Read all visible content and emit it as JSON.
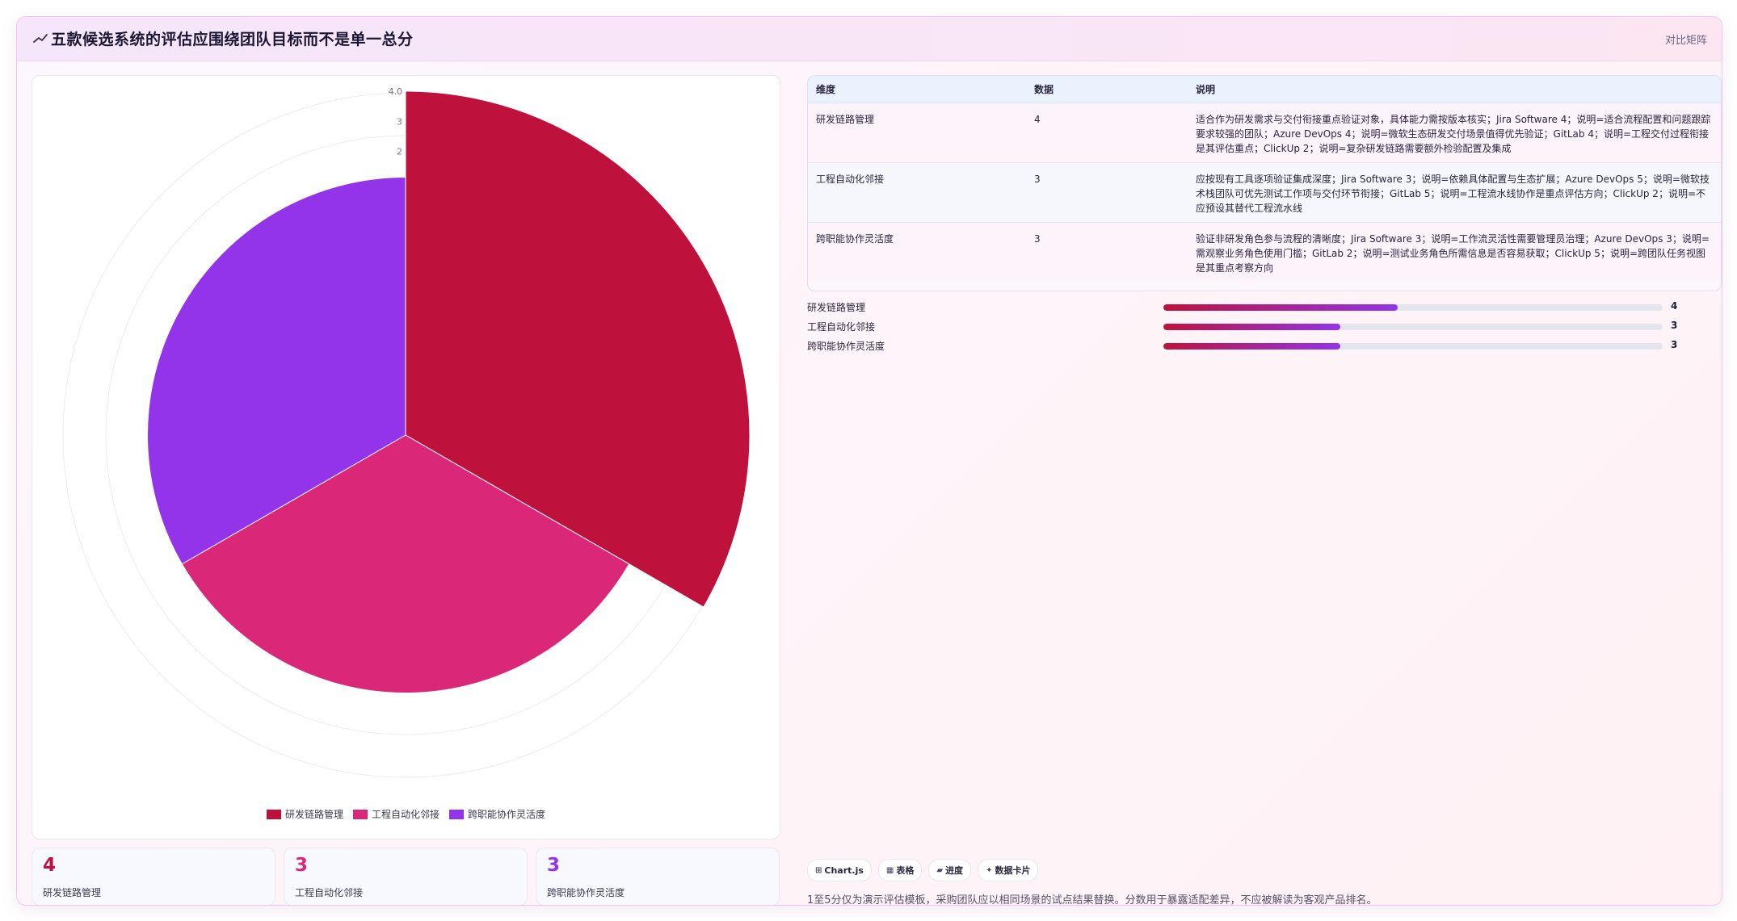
{
  "header": {
    "title": "五款候选系统的评估应围绕团队目标而不是单一总分",
    "title_icon": "trend-line-icon",
    "link": "对比矩阵"
  },
  "colors": {
    "primary": "#be123c",
    "secondary": "#db2777",
    "tertiary": "#9333ea",
    "kpi_values": [
      "#be123c",
      "#db2777",
      "#9333ea"
    ]
  },
  "chart_data": {
    "type": "polarArea",
    "categories": [
      "研发链路管理",
      "工程自动化邻接",
      "跨职能协作灵活度"
    ],
    "values": [
      4,
      3,
      3
    ],
    "colors": [
      "#be123c",
      "#db2777",
      "#9333ea"
    ],
    "r_range": [
      0,
      4
    ],
    "tick_labels": [
      "4.0",
      "3",
      "2"
    ],
    "grid": true,
    "legend_position": "bottom"
  },
  "kpis": [
    {
      "value": "4",
      "label": "研发链路管理"
    },
    {
      "value": "3",
      "label": "工程自动化邻接"
    },
    {
      "value": "3",
      "label": "跨职能协作灵活度"
    }
  ],
  "table": {
    "columns": [
      "维度",
      "数据",
      "说明"
    ],
    "rows": [
      {
        "dim": "研发链路管理",
        "value": "4",
        "desc": "适合作为研发需求与交付衔接重点验证对象，具体能力需按版本核实；Jira Software 4；说明=适合流程配置和问题跟踪要求较强的团队；Azure DevOps 4；说明=微软生态研发交付场景值得优先验证；GitLab 4；说明=工程交付过程衔接是其评估重点；ClickUp 2；说明=复杂研发链路需要额外检验配置及集成"
      },
      {
        "dim": "工程自动化邻接",
        "value": "3",
        "desc": "应按现有工具逐项验证集成深度；Jira Software 3；说明=依赖具体配置与生态扩展；Azure DevOps 5；说明=微软技术栈团队可优先测试工作项与交付环节衔接；GitLab 5；说明=工程流水线协作是重点评估方向；ClickUp 2；说明=不应预设其替代工程流水线"
      },
      {
        "dim": "跨职能协作灵活度",
        "value": "3",
        "desc": "验证非研发角色参与流程的清晰度；Jira Software 3；说明=工作流灵活性需要管理员治理；Azure DevOps 3；说明=需观察业务角色使用门槛；GitLab 2；说明=测试业务角色所需信息是否容易获取；ClickUp 5；说明=跨团队任务视图是其重点考察方向"
      }
    ]
  },
  "progress": [
    {
      "label": "研发链路管理",
      "value": 4,
      "fraction": 0.47,
      "display": "4"
    },
    {
      "label": "工程自动化邻接",
      "value": 3,
      "fraction": 0.355,
      "display": "3"
    },
    {
      "label": "跨职能协作灵活度",
      "value": 3,
      "fraction": 0.355,
      "display": "3"
    }
  ],
  "badges": [
    {
      "icon": "⊞",
      "label": "Chart.js"
    },
    {
      "icon": "▦",
      "label": "表格"
    },
    {
      "icon": "▰",
      "label": "进度"
    },
    {
      "icon": "✦",
      "label": "数据卡片"
    }
  ],
  "footnote": "1至5分仅为演示评估模板，采购团队应以相同场景的试点结果替换。分数用于暴露适配差异，不应被解读为客观产品排名。"
}
